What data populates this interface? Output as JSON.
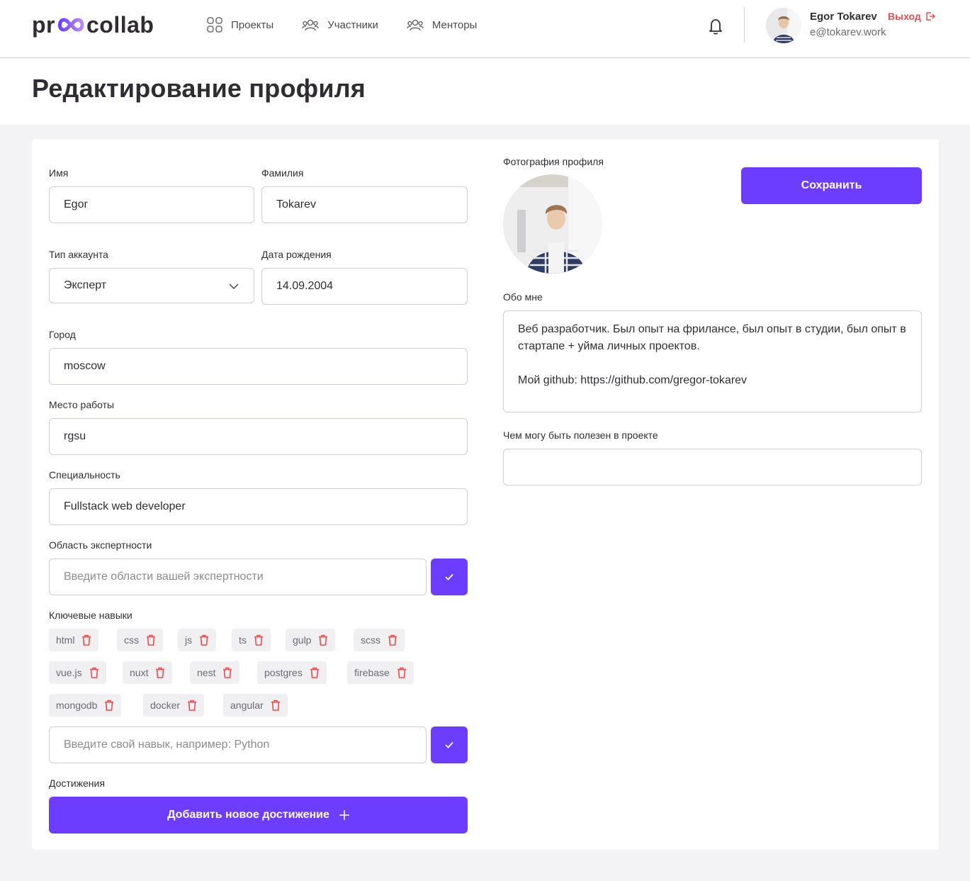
{
  "header": {
    "logo_left": "pr",
    "logo_right": "collab",
    "nav": [
      {
        "label": "Проекты",
        "icon": "grid-icon"
      },
      {
        "label": "Участники",
        "icon": "users-icon"
      },
      {
        "label": "Менторы",
        "icon": "mentors-icon"
      }
    ],
    "user": {
      "name": "Egor Tokarev",
      "email": "e@tokarev.work"
    },
    "logout_label": "Выход"
  },
  "page_title": "Редактирование профиля",
  "form": {
    "first_name": {
      "label": "Имя",
      "value": "Egor"
    },
    "last_name": {
      "label": "Фамилия",
      "value": "Tokarev"
    },
    "account_type": {
      "label": "Тип аккаунта",
      "value": "Эксперт"
    },
    "birth_date": {
      "label": "Дата рождения",
      "value": "14.09.2004"
    },
    "city": {
      "label": "Город",
      "value": "moscow"
    },
    "workplace": {
      "label": "Место работы",
      "value": "rgsu"
    },
    "speciality": {
      "label": "Специальность",
      "value": "Fullstack web developer"
    },
    "expertise": {
      "label": "Область экспертности",
      "placeholder": "Введите области вашей экспертности"
    },
    "skills": {
      "label": "Ключевые навыки",
      "items": [
        "html",
        "css",
        "js",
        "ts",
        "gulp",
        "scss",
        "vue.js",
        "nuxt",
        "nest",
        "postgres",
        "firebase",
        "mongodb",
        "docker",
        "angular"
      ],
      "placeholder": "Введите свой навык, например: Python"
    },
    "achievements": {
      "label": "Достижения",
      "add_label": "Добавить новое достижение"
    },
    "photo": {
      "label": "Фотография профиля"
    },
    "save_label": "Сохранить",
    "about": {
      "label": "Обо мне",
      "value": "Веб разработчик. Был опыт на фрилансе, был опыт в студии, был опыт в стартапе + уйма личных проектов.\n\nМой github: https://github.com/gregor-tokarev"
    },
    "useful": {
      "label": "Чем могу быть полезен в проекте",
      "value": ""
    }
  },
  "colors": {
    "accent": "#6c3cff",
    "danger": "#ea4d4d"
  }
}
